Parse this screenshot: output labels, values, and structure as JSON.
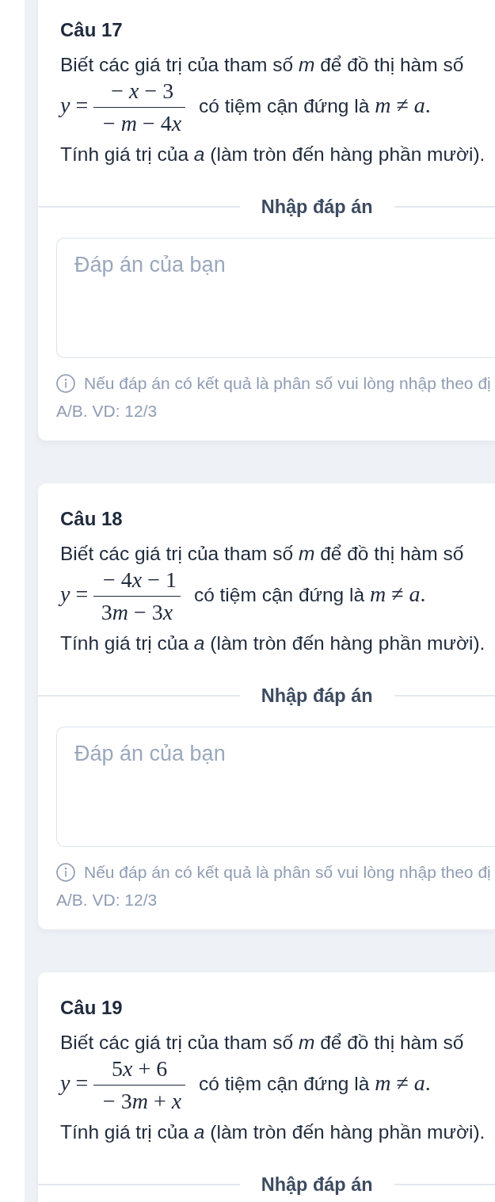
{
  "questions": [
    {
      "title": "Câu 17",
      "statement": {
        "intro": "Biết các giá trị của tham số *m* để đồ thị hàm số",
        "lhs": "y=",
        "numerator": "−x−3",
        "denominator": "−m−4x",
        "tail": "có tiệm cận đứng là",
        "condition": "m≠a."
      },
      "task": "Tính giá trị của *a* (làm tròn đến hàng phần mười).",
      "answer": {
        "heading": "Nhập đáp án",
        "field": {
          "placeholder": "Đáp án của bạn"
        },
        "hint": [
          "Nếu đáp án có kết quả là phân số vui lòng nhập theo đị",
          "A/B. VD: 12/3"
        ]
      }
    },
    {
      "title": "Câu 18",
      "statement": {
        "intro": "Biết các giá trị của tham số *m* để đồ thị hàm số",
        "lhs": "y=",
        "numerator": "−4x−1",
        "denominator": "3m−3x",
        "tail": "có tiệm cận đứng là",
        "condition": "m≠a."
      },
      "task": "Tính giá trị của *a* (làm tròn đến hàng phần mười).",
      "answer": {
        "heading": "Nhập đáp án",
        "field": {
          "placeholder": "Đáp án của bạn"
        },
        "hint": [
          "Nếu đáp án có kết quả là phân số vui lòng nhập theo đị",
          "A/B. VD: 12/3"
        ]
      }
    },
    {
      "title": "Câu 19",
      "statement": {
        "intro": "Biết các giá trị của tham số *m* để đồ thị hàm số",
        "lhs": "y=",
        "numerator": "5x+6",
        "denominator": "−3m+x",
        "tail": "có tiệm cận đứng là",
        "condition": "m≠a."
      },
      "task": "Tính giá trị của *a* (làm tròn đến hàng phần mười).",
      "answer": {
        "heading": "Nhập đáp án"
      }
    }
  ]
}
